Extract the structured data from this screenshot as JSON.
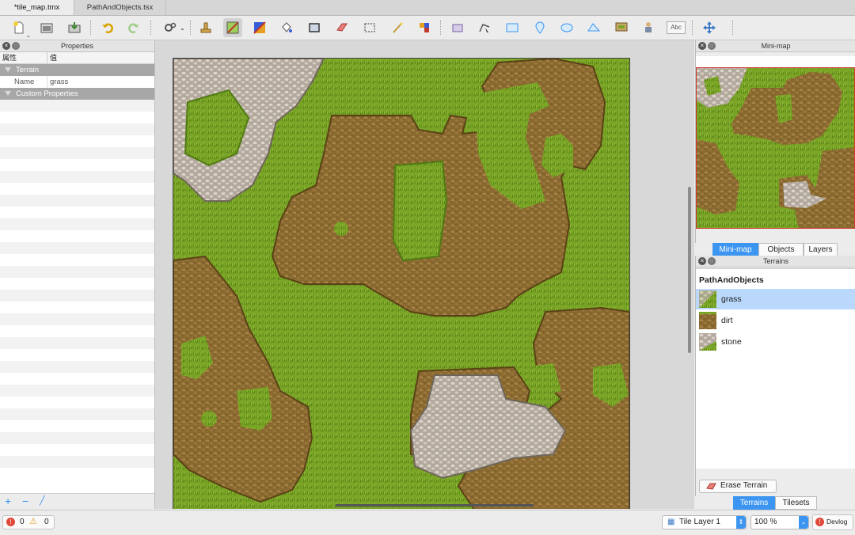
{
  "tabs": [
    {
      "label": "*tile_map.tmx",
      "active": true
    },
    {
      "label": "PathAndObjects.tsx",
      "active": false
    }
  ],
  "toolbar": {
    "icons": [
      "new-map-icon",
      "open-file-icon",
      "save-icon",
      "undo-icon",
      "redo-icon",
      "commands-icon",
      "stamp-brush-icon",
      "terrain-brush-icon",
      "random-mode-icon",
      "bucket-fill-icon",
      "shape-fill-icon",
      "eraser-icon",
      "rect-select-icon",
      "magic-wand-icon",
      "same-tile-select-icon",
      "select-objects-icon",
      "edit-polygons-icon",
      "insert-rectangle-icon",
      "insert-point-icon",
      "insert-ellipse-icon",
      "insert-polygon-icon",
      "insert-tile-icon",
      "insert-template-icon",
      "insert-text-icon",
      "move-icon"
    ],
    "text_tool_label": "Abc"
  },
  "properties": {
    "title": "Properties",
    "col_property": "属性",
    "col_value": "值",
    "section_terrain": "Terrain",
    "name_label": "Name",
    "name_value": "grass",
    "section_custom": "Custom Properties"
  },
  "minimap": {
    "title": "Mini-map"
  },
  "dock_tabs_top": [
    "Mini-map",
    "Objects",
    "Layers"
  ],
  "terrains": {
    "title": "Terrains",
    "tileset_name": "PathAndObjects",
    "items": [
      {
        "label": "grass",
        "selected": true
      },
      {
        "label": "dirt",
        "selected": false
      },
      {
        "label": "stone",
        "selected": false
      }
    ],
    "erase_button": "Erase Terrain"
  },
  "dock_tabs_bottom": [
    "Terrains",
    "Tilesets"
  ],
  "status": {
    "errors": "0",
    "warnings": "0",
    "layer": "Tile Layer 1",
    "zoom": "100 %",
    "devlog": "Devlog"
  },
  "colors": {
    "accent": "#3c95f0",
    "grass": "#7aa526",
    "dirt": "#8a6a30",
    "stone": "#c9bfb4"
  }
}
